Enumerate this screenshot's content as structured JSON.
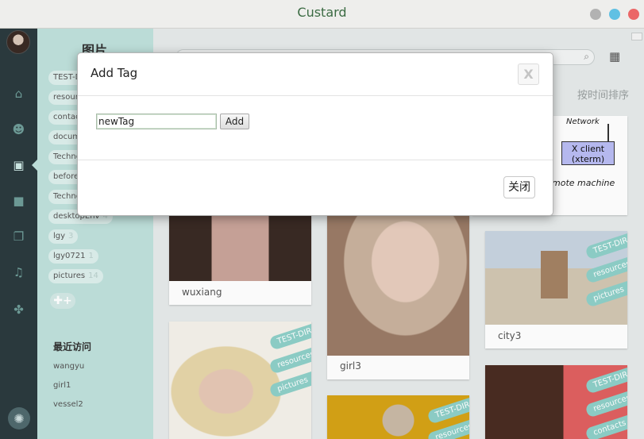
{
  "window": {
    "title": "Custard"
  },
  "sidebar": {
    "title": "图片",
    "tags": [
      {
        "label": "TEST-DIR",
        "count": ""
      },
      {
        "label": "resources",
        "count": ""
      },
      {
        "label": "contacts",
        "count": ""
      },
      {
        "label": "documents",
        "count": ""
      },
      {
        "label": "Technology",
        "count": ""
      },
      {
        "label": "before",
        "count": ""
      },
      {
        "label": "Technology",
        "count": ""
      },
      {
        "label": "desktopEnv",
        "count": "4"
      },
      {
        "label": "lgy",
        "count": "3"
      },
      {
        "label": "lgy0721",
        "count": "1"
      },
      {
        "label": "pictures",
        "count": "14"
      }
    ],
    "add_tag_symbol": "✚+",
    "recent_title": "最近访问",
    "recent": [
      "wangyu",
      "girl1",
      "vessel2"
    ]
  },
  "main": {
    "sort_label": "按时间排序",
    "cards": [
      {
        "caption": "wuxiang",
        "tags": []
      },
      {
        "caption": "girl3",
        "tags": []
      },
      {
        "caption": "city3",
        "tags": [
          "TEST-DIR",
          "resources",
          "pictures"
        ]
      },
      {
        "caption": "",
        "tags": [
          "TEST-DIR",
          "resources",
          "pictures"
        ]
      },
      {
        "caption": "",
        "tags": [
          "TEST-DIR",
          "resources"
        ]
      },
      {
        "caption": "",
        "tags": [
          "TEST-DIR",
          "resources",
          "contacts"
        ]
      }
    ],
    "network_diagram": {
      "network": "Network",
      "client_line1": "X client",
      "client_line2": "(xterm)",
      "machine": "mote machine"
    }
  },
  "dialog": {
    "title": "Add Tag",
    "close_x": "X",
    "input_value": "newTag",
    "add_label": "Add",
    "close_label": "关闭"
  },
  "colors": {
    "accent": "#bfe1dc",
    "rail": "#2b3b3f",
    "ribbon": "#8ed0c8",
    "title": "#3d6e45"
  }
}
